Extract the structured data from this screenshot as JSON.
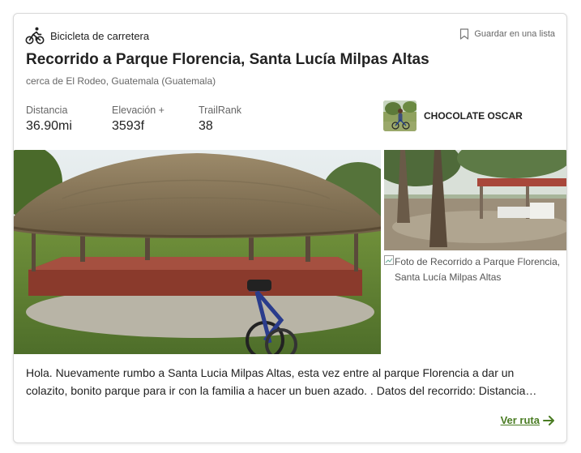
{
  "card": {
    "activity": {
      "icon": "cyclist-icon",
      "label": "Bicicleta de carretera"
    },
    "save": {
      "icon": "bookmark-icon",
      "label": "Guardar en una lista"
    },
    "title": "Recorrido a Parque Florencia, Santa Lucía Milpas Altas",
    "location": "cerca de El Rodeo, Guatemala (Guatemala)",
    "stats": [
      {
        "label": "Distancia",
        "value": "36.90mi"
      },
      {
        "label": "Elevación +",
        "value": "3593f"
      },
      {
        "label": "TrailRank",
        "value": "38"
      }
    ],
    "author": {
      "name": "CHOCOLATE OSCAR"
    },
    "photos": {
      "broken_alt": "Foto de Recorrido a Parque Florencia, Santa Lucía Milpas Altas"
    },
    "description": {
      "line1": "Hola. Nuevamente rumbo a Santa Lucia Milpas Altas, esta vez entre al parque Florencia a dar un",
      "line2": "colazito, bonito parque para ir con la familia a hacer un buen azado. . Datos del recorrido: Distancia…"
    },
    "route": {
      "label": "Ver ruta",
      "icon": "arrow-right-icon"
    },
    "colors": {
      "accent": "#4a7c23",
      "muted": "#666666",
      "text": "#222222",
      "border": "#d9d9d9"
    }
  }
}
